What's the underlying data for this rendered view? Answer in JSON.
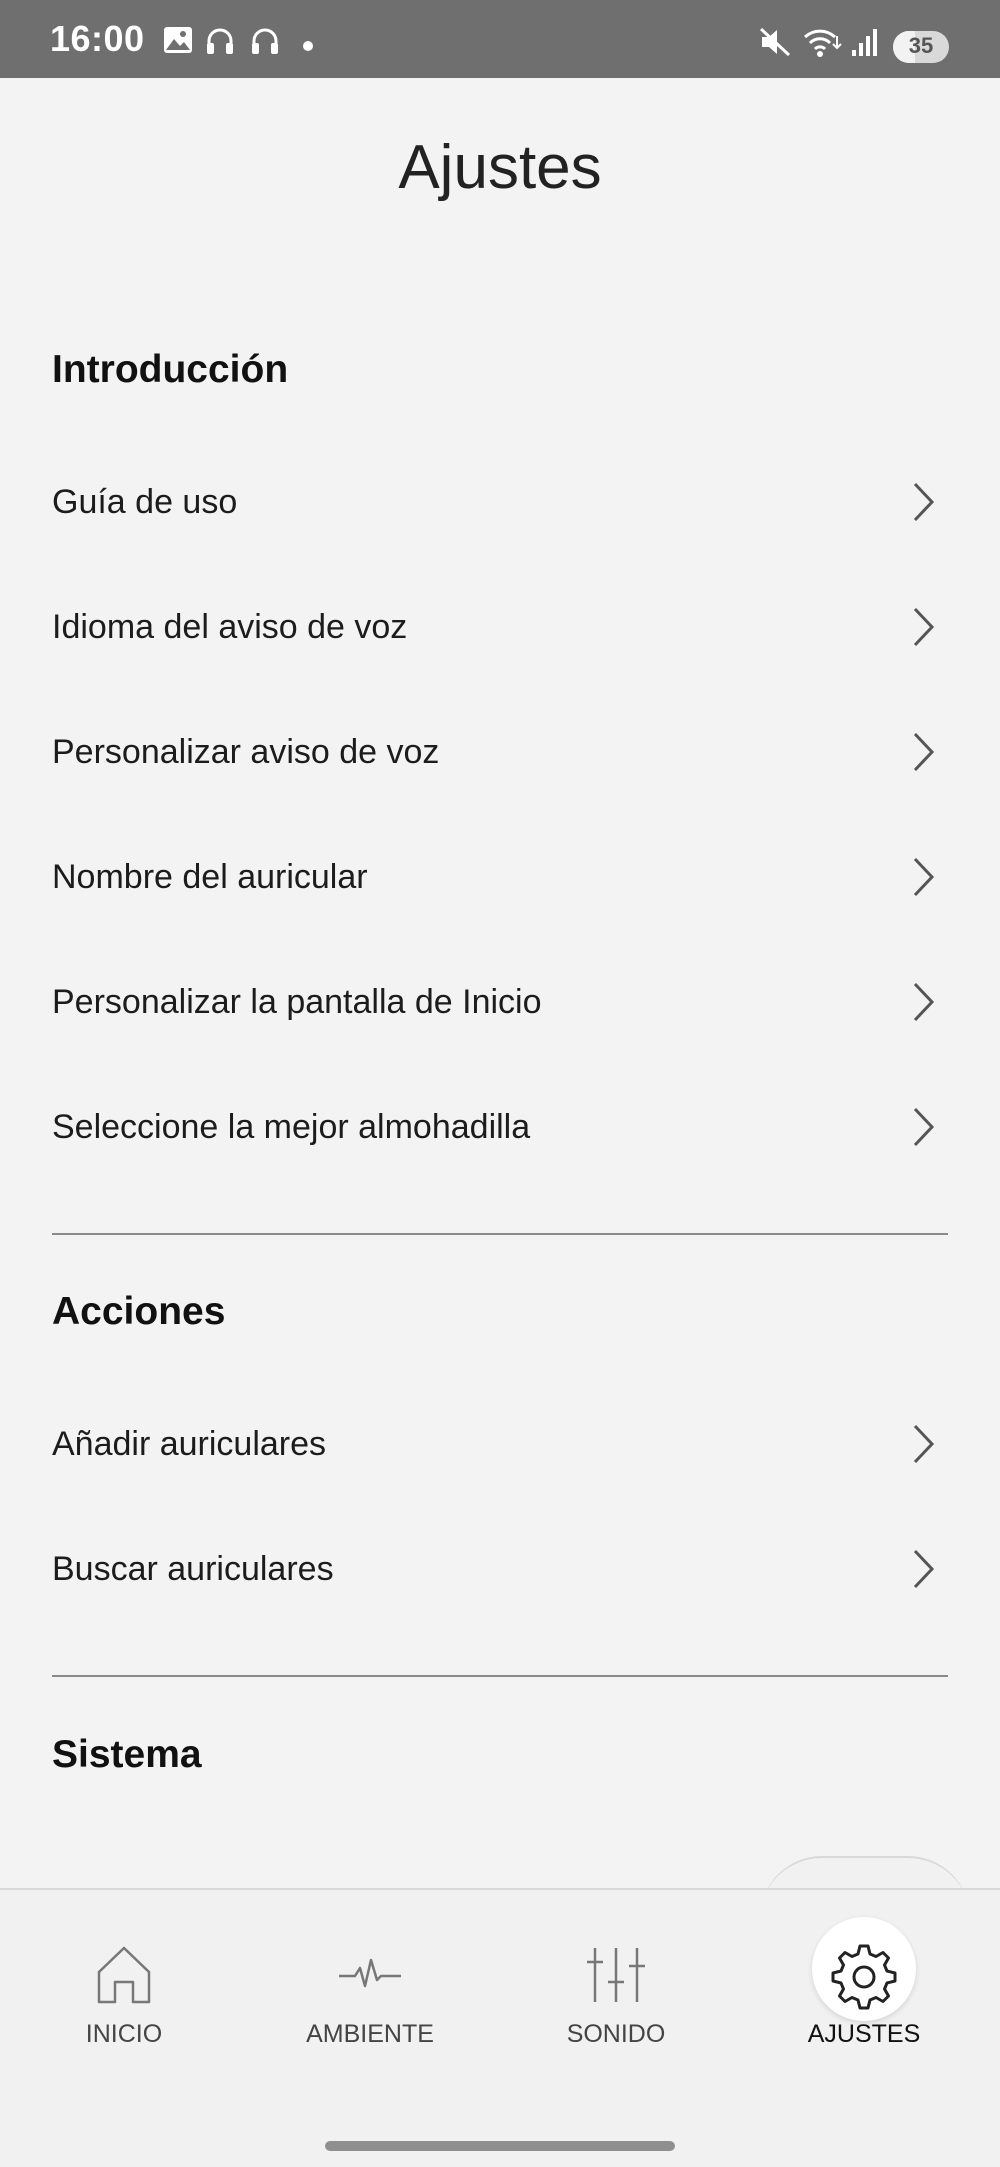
{
  "status_bar": {
    "time": "16:00",
    "battery": "35",
    "icons": [
      "image-icon",
      "headphones-icon",
      "headphones-icon",
      "dot-icon",
      "mute-icon",
      "wifi-icon",
      "signal-icon",
      "battery-icon"
    ]
  },
  "page": {
    "title": "Ajustes"
  },
  "sections": {
    "intro": {
      "title": "Introducción",
      "items": [
        "Guía de uso",
        "Idioma del aviso de voz",
        "Personalizar aviso de voz",
        "Nombre del auricular",
        "Personalizar la pantalla de Inicio",
        "Seleccione la mejor almohadilla"
      ]
    },
    "actions": {
      "title": "Acciones",
      "items": [
        "Añadir auriculares",
        "Buscar auriculares"
      ]
    },
    "system": {
      "title": "Sistema"
    }
  },
  "bottom_nav": {
    "active": "AJUSTES",
    "items": [
      {
        "label": "INICIO",
        "icon": "home-icon"
      },
      {
        "label": "AMBIENTE",
        "icon": "waveform-icon"
      },
      {
        "label": "SONIDO",
        "icon": "equalizer-icon"
      },
      {
        "label": "AJUSTES",
        "icon": "gear-icon"
      }
    ]
  }
}
